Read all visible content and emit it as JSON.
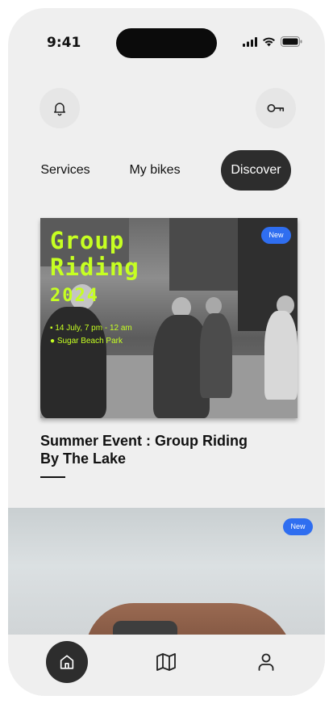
{
  "status_bar": {
    "time": "9:41"
  },
  "header": {
    "left_icon": "bell-icon",
    "right_icon": "key-icon"
  },
  "tabs": [
    {
      "label": "Services",
      "active": false
    },
    {
      "label": "My bikes",
      "active": false
    },
    {
      "label": "Discover",
      "active": true
    }
  ],
  "featured_event": {
    "badge": "New",
    "poster": {
      "title_line1": "Group",
      "title_line2": "Riding",
      "year": "2024",
      "date_line": "14 July, 7 pm - 12 am",
      "location_line": "Sugar Beach Park"
    },
    "title": "Summer Event : Group Riding By The Lake"
  },
  "second_card": {
    "badge": "New"
  },
  "bottom_nav": {
    "items": [
      {
        "icon": "home-icon",
        "active": true
      },
      {
        "icon": "map-icon",
        "active": false
      },
      {
        "icon": "profile-icon",
        "active": false
      }
    ]
  },
  "colors": {
    "accent_dark": "#2d2d2d",
    "badge_blue": "#2f6ef0",
    "poster_green": "#c6ff22",
    "background": "#efefef"
  }
}
